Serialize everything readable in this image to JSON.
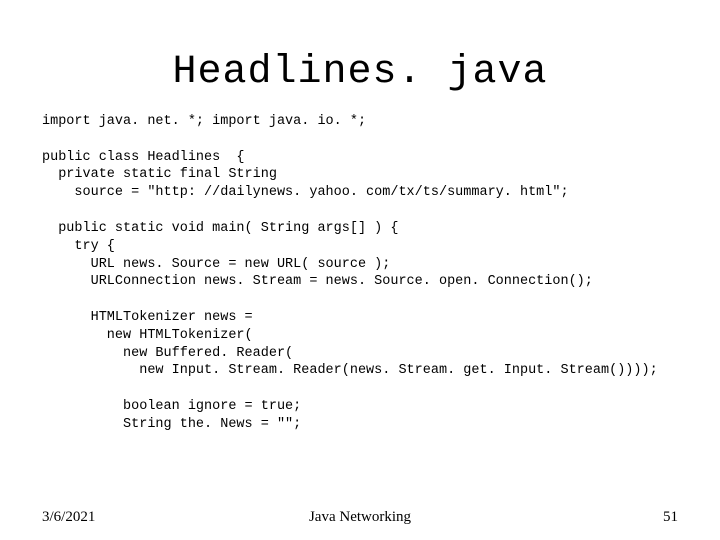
{
  "title": "Headlines. java",
  "code": "import java. net. *; import java. io. *;\n\npublic class Headlines  {\n  private static final String\n    source = \"http: //dailynews. yahoo. com/tx/ts/summary. html\";\n\n  public static void main( String args[] ) {\n    try {\n      URL news. Source = new URL( source );\n      URLConnection news. Stream = news. Source. open. Connection();\n\n      HTMLTokenizer news =\n        new HTMLTokenizer(\n          new Buffered. Reader(\n            new Input. Stream. Reader(news. Stream. get. Input. Stream())));\n\n          boolean ignore = true;\n          String the. News = \"\";",
  "footer": {
    "date": "3/6/2021",
    "center": "Java Networking",
    "page": "51"
  }
}
